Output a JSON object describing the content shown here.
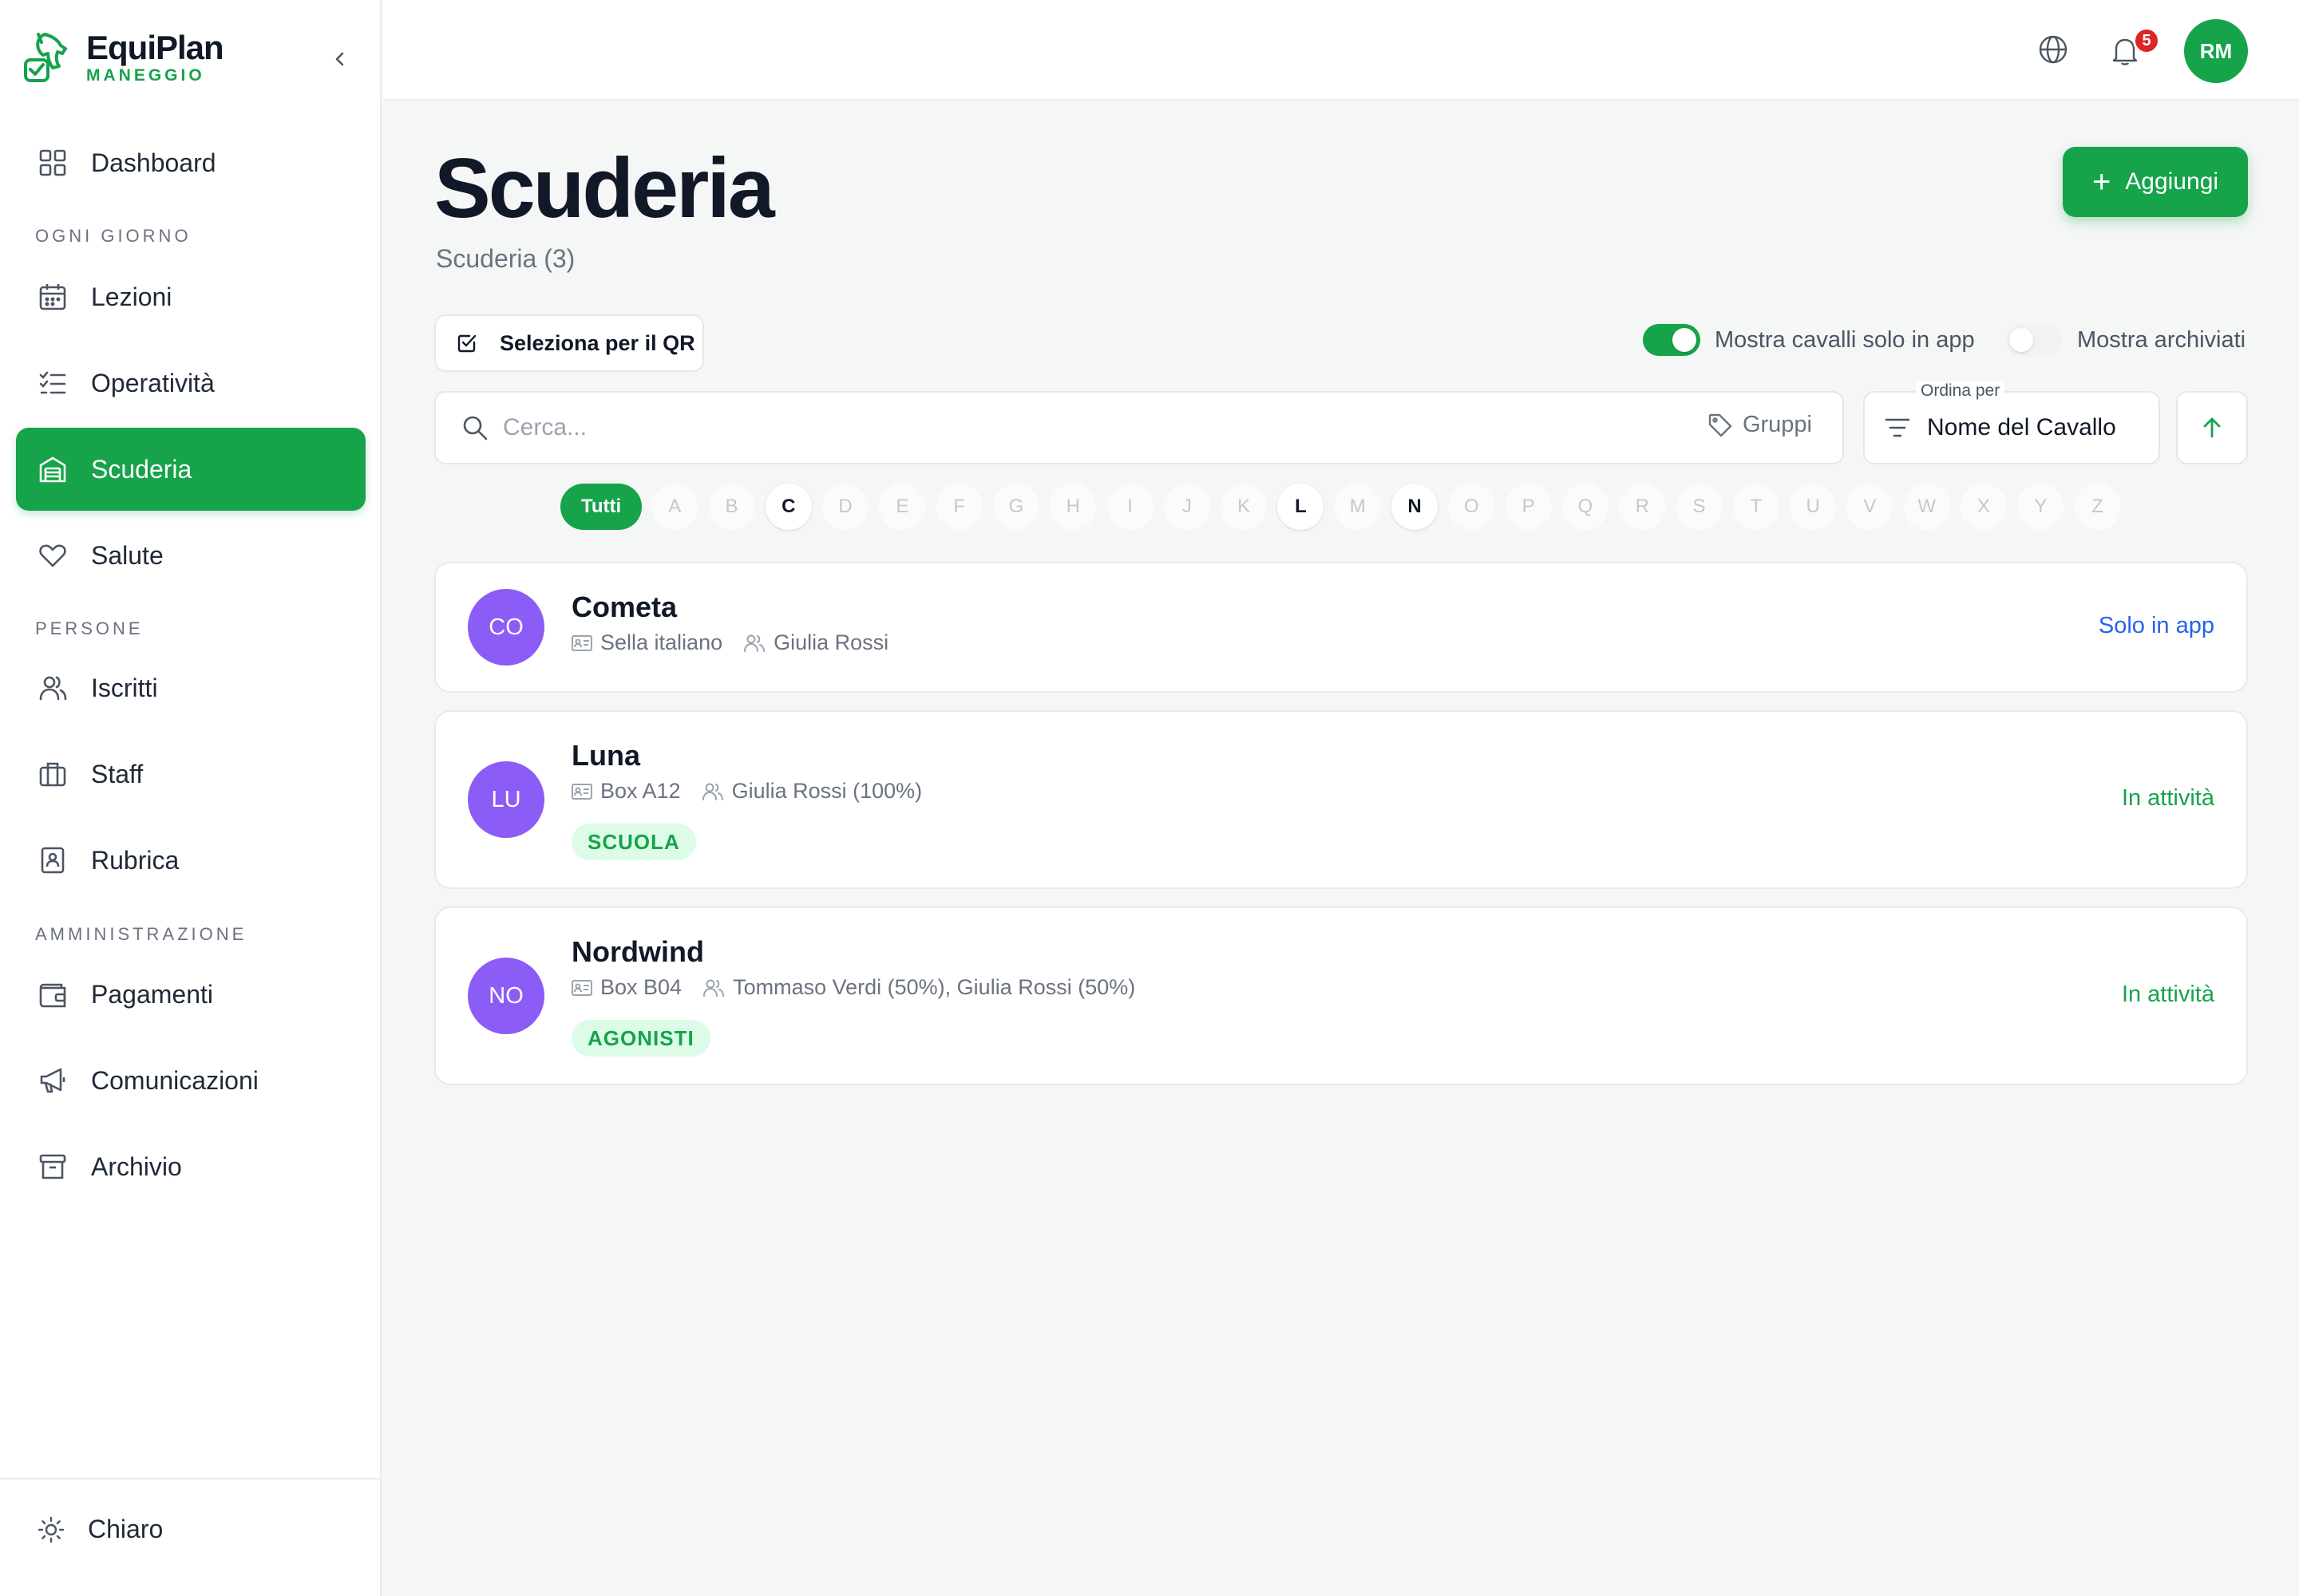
{
  "app": {
    "name": "EquiPlan",
    "subtitle": "MANEGGIO"
  },
  "sidebar": {
    "dashboard": "Dashboard",
    "sections": {
      "daily": "OGNI GIORNO",
      "people": "PERSONE",
      "admin": "AMMINISTRAZIONE"
    },
    "items": {
      "lezioni": "Lezioni",
      "operativita": "Operatività",
      "scuderia": "Scuderia",
      "salute": "Salute",
      "iscritti": "Iscritti",
      "staff": "Staff",
      "rubrica": "Rubrica",
      "pagamenti": "Pagamenti",
      "comunicazioni": "Comunicazioni",
      "archivio": "Archivio"
    },
    "theme": "Chiaro"
  },
  "topbar": {
    "notifications_count": "5",
    "user_initials": "RM"
  },
  "page": {
    "title": "Scuderia",
    "subtitle": "Scuderia (3)",
    "add_label": "Aggiungi",
    "qr_label": "Seleziona per il QR",
    "toggle_app_only": "Mostra cavalli solo in app",
    "toggle_app_only_on": true,
    "toggle_archived": "Mostra archiviati",
    "toggle_archived_on": false,
    "search_placeholder": "Cerca...",
    "groups_label": "Gruppi",
    "sort_float_label": "Ordina per",
    "sort_value": "Nome del Cavallo",
    "alpha_all": "Tutti",
    "alphabet": [
      "A",
      "B",
      "C",
      "D",
      "E",
      "F",
      "G",
      "H",
      "I",
      "J",
      "K",
      "L",
      "M",
      "N",
      "O",
      "P",
      "Q",
      "R",
      "S",
      "T",
      "U",
      "V",
      "W",
      "X",
      "Y",
      "Z"
    ],
    "alpha_available": [
      "C",
      "L",
      "N"
    ]
  },
  "horses": [
    {
      "initials": "CO",
      "name": "Cometa",
      "location": "Sella italiano",
      "owners": "Giulia Rossi",
      "tag": "",
      "status": "Solo in app",
      "status_color": "#2563eb"
    },
    {
      "initials": "LU",
      "name": "Luna",
      "location": "Box A12",
      "owners": "Giulia Rossi (100%)",
      "tag": "SCUOLA",
      "status": "In attività",
      "status_color": "#16a34a"
    },
    {
      "initials": "NO",
      "name": "Nordwind",
      "location": "Box B04",
      "owners": "Tommaso Verdi (50%), Giulia Rossi (50%)",
      "tag": "AGONISTI",
      "status": "In attività",
      "status_color": "#16a34a"
    }
  ],
  "colors": {
    "brand": "#16a34a",
    "avatar": "#8b5cf6",
    "link": "#2563eb",
    "badge": "#dc2626"
  }
}
